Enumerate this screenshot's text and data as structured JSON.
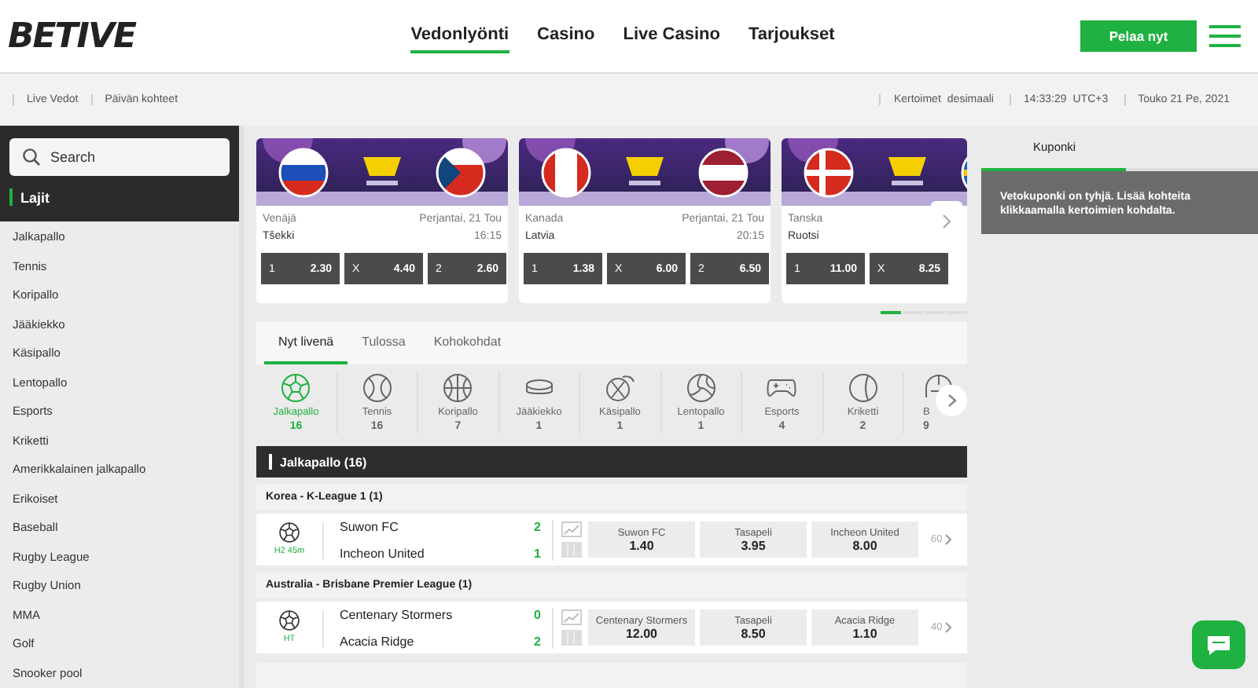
{
  "header": {
    "logo": "BETIVE",
    "nav": [
      {
        "label": "Vedonlyönti",
        "selected": true
      },
      {
        "label": "Casino",
        "selected": false
      },
      {
        "label": "Live Casino",
        "selected": false
      },
      {
        "label": "Tarjoukset",
        "selected": false
      }
    ],
    "play_button": "Pelaa nyt"
  },
  "subbar": {
    "links": [
      "Live Vedot",
      "Päivän kohteet"
    ],
    "odds_label": "Kertoimet",
    "odds_format": "desimaali",
    "time": "14:33:29",
    "timezone": "UTC+3",
    "date": "Touko 21 Pe, 2021"
  },
  "sidebar": {
    "search_placeholder": "Search",
    "section": "Lajit",
    "items": [
      "Jalkapallo",
      "Tennis",
      "Koripallo",
      "Jääkiekko",
      "Käsipallo",
      "Lentopallo",
      "Esports",
      "Kriketti",
      "Amerikkalainen jalkapallo",
      "Erikoiset",
      "Baseball",
      "Rugby League",
      "Rugby Union",
      "MMA",
      "Golf",
      "Snooker pool"
    ]
  },
  "featured": [
    {
      "team1": "Venäjä",
      "team2": "Tšekki",
      "date": "Perjantai, 21 Tou",
      "time": "16:15",
      "odds": [
        {
          "label": "1",
          "value": "2.30"
        },
        {
          "label": "X",
          "value": "4.40"
        },
        {
          "label": "2",
          "value": "2.60"
        }
      ]
    },
    {
      "team1": "Kanada",
      "team2": "Latvia",
      "date": "Perjantai, 21 Tou",
      "time": "20:15",
      "odds": [
        {
          "label": "1",
          "value": "1.38"
        },
        {
          "label": "X",
          "value": "6.00"
        },
        {
          "label": "2",
          "value": "6.50"
        }
      ]
    },
    {
      "team1": "Tanska",
      "team2": "Ruotsi",
      "odds": [
        {
          "label": "1",
          "value": "11.00"
        },
        {
          "label": "X",
          "value": "8.25"
        }
      ]
    }
  ],
  "carousel_pages": [
    {
      "selected": true
    },
    {
      "selected": false
    },
    {
      "selected": false
    },
    {
      "selected": false
    }
  ],
  "live_tabs": [
    {
      "label": "Nyt livenä",
      "selected": true
    },
    {
      "label": "Tulossa",
      "selected": false
    },
    {
      "label": "Kohokohdat",
      "selected": false
    }
  ],
  "sports": [
    {
      "label": "Jalkapallo",
      "count": "16",
      "selected": true
    },
    {
      "label": "Tennis",
      "count": "16",
      "selected": false
    },
    {
      "label": "Koripallo",
      "count": "7",
      "selected": false
    },
    {
      "label": "Jääkiekko",
      "count": "1",
      "selected": false
    },
    {
      "label": "Käsipallo",
      "count": "1",
      "selected": false
    },
    {
      "label": "Lentopallo",
      "count": "1",
      "selected": false
    },
    {
      "label": "Esports",
      "count": "4",
      "selected": false
    },
    {
      "label": "Kriketti",
      "count": "2",
      "selected": false
    },
    {
      "label": "B",
      "count": "9",
      "selected": false
    }
  ],
  "section_title": "Jalkapallo (16)",
  "leagues": [
    {
      "name": "Korea - K-League 1 (1)",
      "matches": [
        {
          "status": "H2 45m",
          "home": "Suwon FC",
          "away": "Incheon United",
          "home_score": "2",
          "away_score": "1",
          "odds": [
            {
              "label": "Suwon FC",
              "value": "1.40"
            },
            {
              "label": "Tasapeli",
              "value": "3.95"
            },
            {
              "label": "Incheon United",
              "value": "8.00"
            }
          ],
          "more": "60"
        }
      ]
    },
    {
      "name": "Australia - Brisbane Premier League (1)",
      "matches": [
        {
          "status": "HT",
          "home": "Centenary Stormers",
          "away": "Acacia Ridge",
          "home_score": "0",
          "away_score": "2",
          "odds": [
            {
              "label": "Centenary Stormers",
              "value": "12.00"
            },
            {
              "label": "Tasapeli",
              "value": "8.50"
            },
            {
              "label": "Acacia Ridge",
              "value": "1.10"
            }
          ],
          "more": "40"
        }
      ]
    }
  ],
  "coupon": {
    "title": "Kuponki",
    "message": "Vetokuponki on tyhjä. Lisää kohteita klikkaamalla kertoimien kohdalta."
  }
}
